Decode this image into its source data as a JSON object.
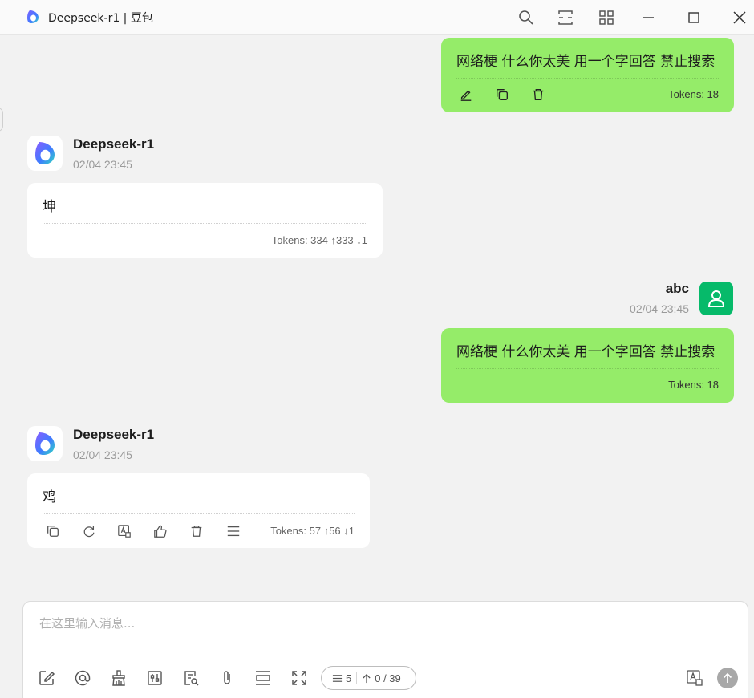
{
  "window": {
    "title": "Deepseek-r1 | 豆包",
    "icons": [
      "search-icon",
      "fullscreen-icon",
      "grid-icon",
      "minimize-icon",
      "maximize-icon",
      "close-icon"
    ]
  },
  "messages": {
    "m1": {
      "text": "网络梗 什么你太美 用一个字回答 禁止搜索",
      "tokens": "Tokens: 18"
    },
    "m2": {
      "name": "Deepseek-r1",
      "time": "02/04 23:45",
      "text": "坤",
      "tokens": "Tokens: 334 ↑333 ↓1"
    },
    "m3": {
      "name": "abc",
      "time": "02/04 23:45",
      "text": "网络梗 什么你太美 用一个字回答 禁止搜索",
      "tokens": "Tokens: 18"
    },
    "m4": {
      "name": "Deepseek-r1",
      "time": "02/04 23:45",
      "text": "鸡",
      "tokens": "Tokens: 57 ↑56 ↓1"
    }
  },
  "input": {
    "placeholder": "在这里输入消息...",
    "context_count": "5",
    "token_counter": "0 / 39"
  },
  "colors": {
    "user_bubble": "#95ec69",
    "user_avatar": "#06ba6a",
    "background": "#f2f2f2"
  }
}
